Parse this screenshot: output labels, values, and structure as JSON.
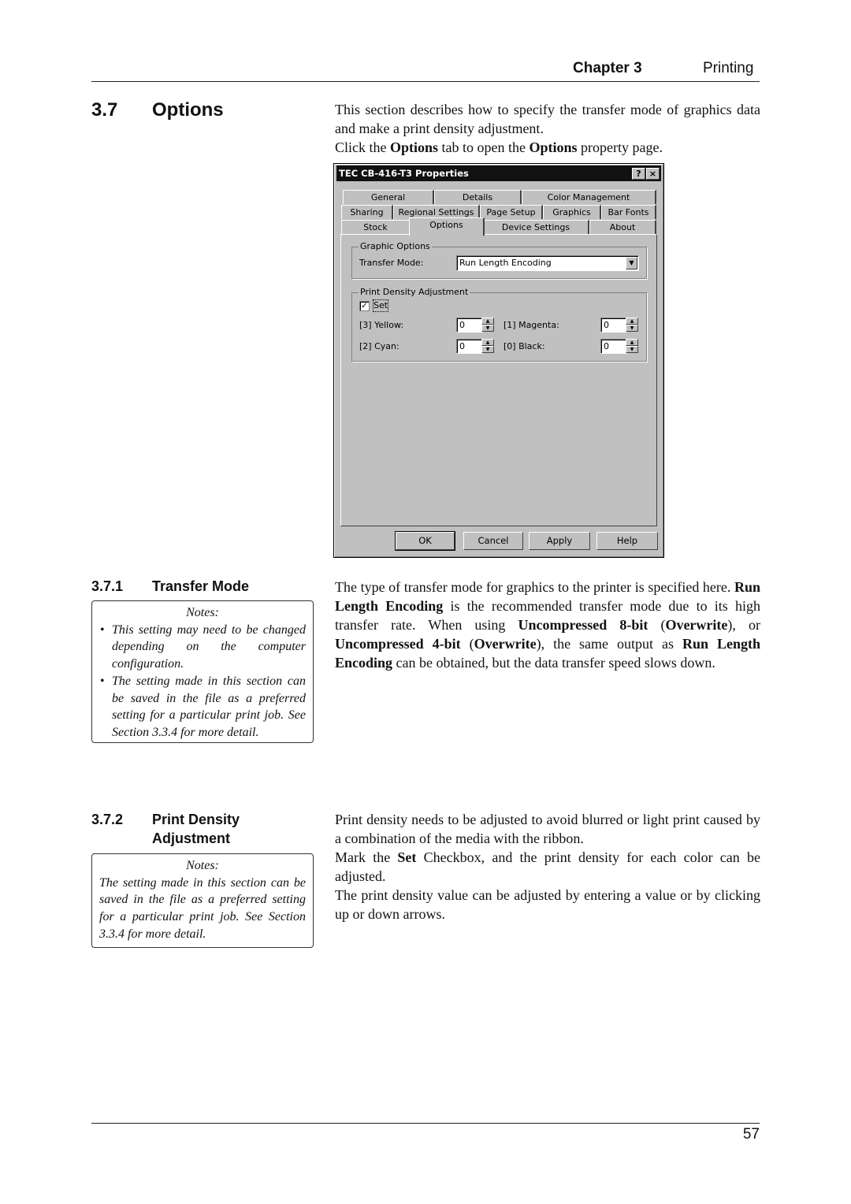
{
  "header": {
    "chapter": "Chapter 3",
    "section": "Printing"
  },
  "section": {
    "number": "3.7",
    "title": "Options",
    "intro": [
      "This section describes how to specify the transfer mode of graphics data and make a print density adjustment.",
      "Click the ",
      "Options",
      " tab to open the ",
      "Options",
      " property page."
    ]
  },
  "dialog": {
    "title": "TEC CB-416-T3 Properties",
    "help_btn": "?",
    "close_btn": "×",
    "tabs_row1": [
      "General",
      "Details",
      "Color Management"
    ],
    "tabs_row2": [
      "Sharing",
      "Regional Settings",
      "Page Setup",
      "Graphics",
      "Bar Fonts"
    ],
    "tabs_row3": [
      "Stock",
      "Options",
      "Device Settings",
      "About"
    ],
    "active_tab": "Options",
    "graphic_options": {
      "label": "Graphic Options",
      "transfer_mode_label": "Transfer Mode:",
      "transfer_mode_value": "Run Length Encoding"
    },
    "print_density": {
      "label": "Print Density Adjustment",
      "set_label": "Set",
      "set_checked": true,
      "yellow_label": "[3] Yellow:",
      "yellow_value": "0",
      "magenta_label": "[1] Magenta:",
      "magenta_value": "0",
      "cyan_label": "[2] Cyan:",
      "cyan_value": "0",
      "black_label": "[0] Black:",
      "black_value": "0"
    },
    "buttons": {
      "ok": "OK",
      "cancel": "Cancel",
      "apply": "Apply",
      "help": "Help"
    }
  },
  "sub1": {
    "number": "3.7.1",
    "title": "Transfer Mode",
    "notes_title": "Notes:",
    "notes": [
      "This setting may need to be changed depending on the computer configuration.",
      "The setting made in this section can be saved in the file as a preferred setting for a particular print job. See Section 3.3.4 for more detail."
    ],
    "text": [
      "The type of transfer mode for graphics to the printer is specified here. ",
      "Run Length Encoding",
      " is the recommended transfer mode due to its high transfer rate.  When using ",
      "Uncompressed 8-bit",
      " (",
      "Overwrite",
      "), or ",
      "Uncompressed  4-bit",
      " (",
      "Overwrite",
      "), the same output as ",
      "Run Length Encoding",
      " can be obtained, but the data transfer speed slows down."
    ]
  },
  "sub2": {
    "number": "3.7.2",
    "title_line1": "Print Density",
    "title_line2": "Adjustment",
    "notes_title": "Notes:",
    "note": "The setting made in this section can be saved in the file as a preferred setting for a particular print job. See Section 3.3.4 for more detail.",
    "text": [
      "Print density needs to be adjusted to avoid blurred or light print caused by a combination of the media with the ribbon.",
      "Mark the ",
      "Set",
      " Checkbox, and the print density for each color can be adjusted.",
      "The print density value can be adjusted by entering a value or by clicking up or down arrows."
    ]
  },
  "footer": {
    "page_number": "57"
  }
}
